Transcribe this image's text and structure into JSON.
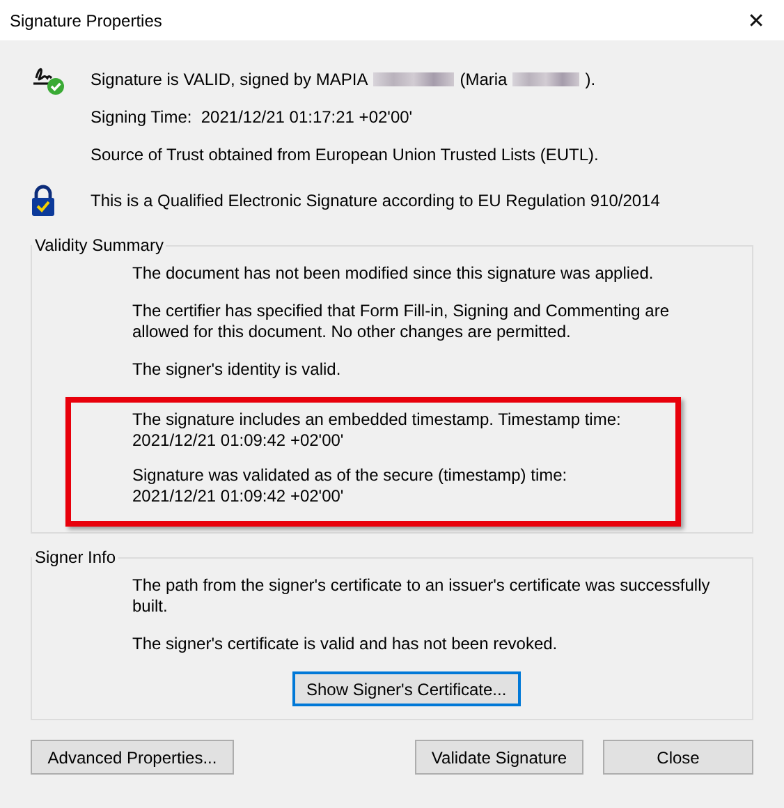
{
  "window": {
    "title": "Signature Properties",
    "close": "✕"
  },
  "header": [
    {
      "kind": "signature",
      "parts": [
        {
          "kind": "text",
          "text": "Signature is VALID, signed by MAPIA"
        },
        {
          "kind": "redacted"
        },
        {
          "kind": "text",
          "text": "(Maria"
        },
        {
          "kind": "redacted"
        },
        {
          "kind": "text",
          "text": ")."
        }
      ]
    },
    {
      "kind": "none",
      "parts": [
        {
          "kind": "text",
          "text": "Signing Time:  2021/12/21 01:17:21 +02'00'"
        }
      ]
    },
    {
      "kind": "none",
      "parts": [
        {
          "kind": "text",
          "text": "Source of Trust obtained from European Union Trusted Lists (EUTL)."
        }
      ]
    },
    {
      "kind": "qualified",
      "parts": [
        {
          "kind": "text",
          "text": "This is a Qualified Electronic Signature according to EU Regulation 910/2014"
        }
      ]
    }
  ],
  "validity_summary": {
    "title": "Validity Summary",
    "items": [
      {
        "text": "The document has not been modified since this signature was applied.",
        "highlighted": false
      },
      {
        "text": "The certifier has specified that Form Fill-in, Signing and Commenting are\nallowed for this document. No other changes are permitted.",
        "highlighted": false
      },
      {
        "text": "The signer's identity is valid.",
        "highlighted": false
      },
      {
        "text": "The signature includes an embedded timestamp. Timestamp time:\n2021/12/21 01:09:42 +02'00'",
        "highlighted": true
      },
      {
        "text": "Signature was validated as of the secure (timestamp) time:\n2021/12/21 01:09:42 +02'00'",
        "highlighted": true
      }
    ]
  },
  "signer_info": {
    "title": "Signer Info",
    "items": [
      {
        "text": "The path from the signer's certificate to an issuer's certificate was successfully\nbuilt."
      },
      {
        "text": "The signer's certificate is valid and has not been revoked."
      }
    ],
    "button": {
      "label": "Show Signer's Certificate...",
      "focused": true
    }
  },
  "buttons": [
    {
      "label": "Advanced Properties..."
    },
    {
      "label": "Validate Signature"
    },
    {
      "label": "Close"
    }
  ]
}
